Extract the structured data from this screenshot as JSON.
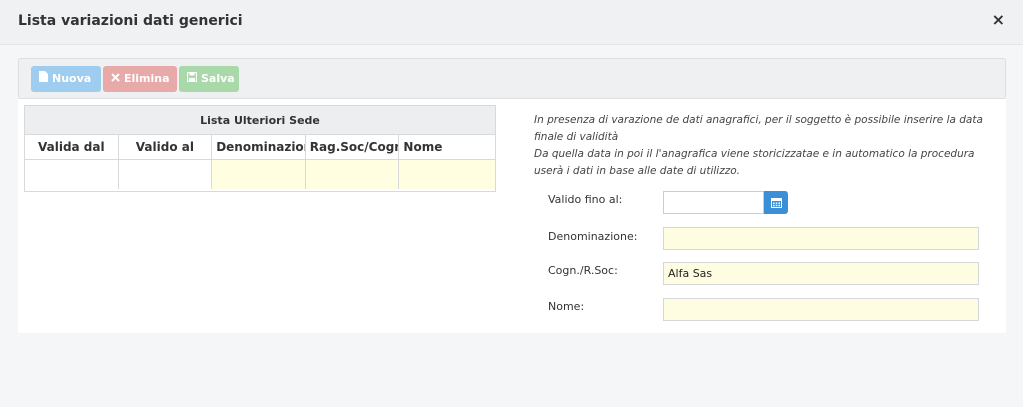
{
  "modal": {
    "title": "Lista variazioni dati generici",
    "close_glyph": "×"
  },
  "toolbar": {
    "nuova": {
      "label": "Nuova",
      "icon": "file-icon",
      "color": "#9fcdf0"
    },
    "elimina": {
      "label": "Elimina",
      "icon": "close-icon",
      "color": "#e8a9a9"
    },
    "salva": {
      "label": "Salva",
      "icon": "floppy-icon",
      "color": "#a9d9a9"
    }
  },
  "grid": {
    "caption": "Lista Ulteriori Sede",
    "columns": [
      "Valida dal",
      "Valido al",
      "Denominazione",
      "Rag.Soc/Cognome",
      "Nome"
    ]
  },
  "info": {
    "line1": "In presenza di varazione de dati anagrafici, per il soggetto è possibile inserire la data finale di validità",
    "line2": "Da quella data in poi il l'anagrafica viene storicizzatae e in automatico la procedura userà i dati in base alle date di utilizzo."
  },
  "form": {
    "valido_fino_label": "Valido fino al:",
    "valido_fino_value": "",
    "denominazione_label": "Denominazione:",
    "denominazione_value": "",
    "cognome_label": "Cogn./R.Soc:",
    "cognome_value": "Alfa Sas",
    "nome_label": "Nome:",
    "nome_value": ""
  },
  "colors": {
    "accent": "#3a8fd6",
    "input_yellow": "#fffde1"
  }
}
